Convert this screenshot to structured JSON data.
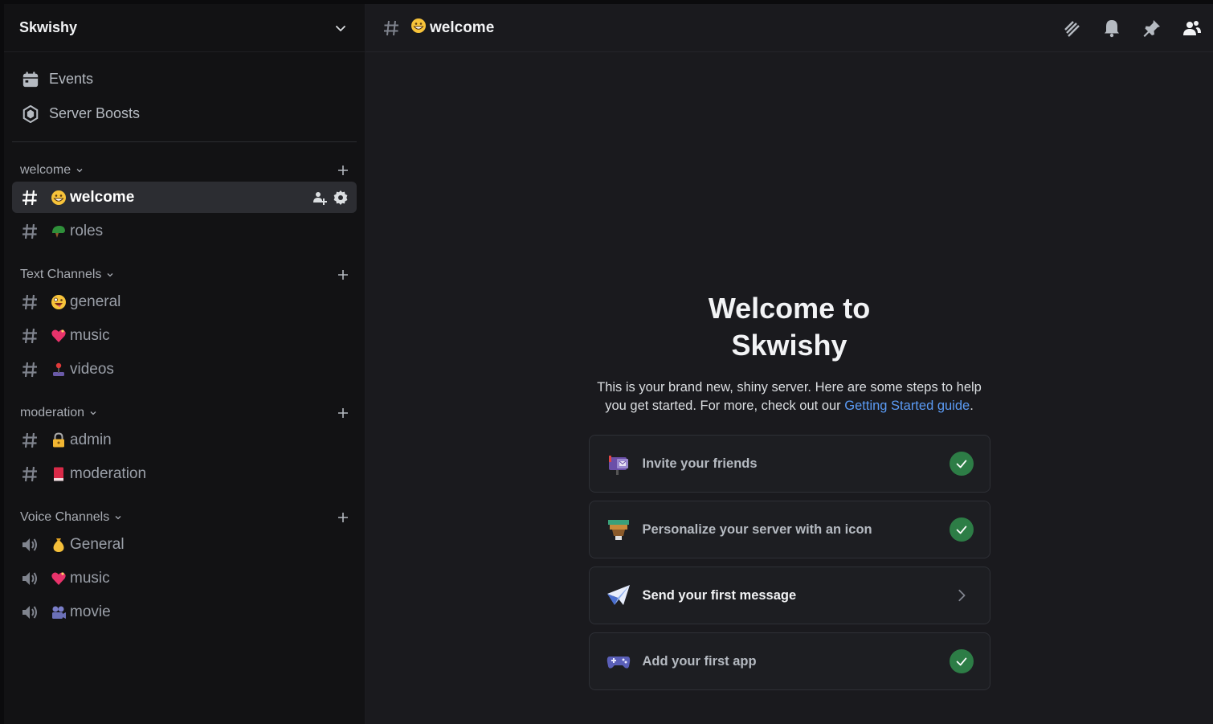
{
  "server": {
    "name": "Skwishy"
  },
  "top_items": [
    {
      "label": "Events",
      "icon": "calendar-icon"
    },
    {
      "label": "Server Boosts",
      "icon": "boost-icon"
    }
  ],
  "categories": [
    {
      "name": "welcome",
      "channels": [
        {
          "name": "welcome",
          "emoji": "grinning-emoji",
          "type": "text",
          "active": true
        },
        {
          "name": "roles",
          "emoji": "helmet-emoji",
          "type": "text"
        }
      ]
    },
    {
      "name": "Text Channels",
      "channels": [
        {
          "name": "general",
          "emoji": "zany-face-emoji",
          "type": "text"
        },
        {
          "name": "music",
          "emoji": "heart-emoji",
          "type": "text"
        },
        {
          "name": "videos",
          "emoji": "joystick-emoji",
          "type": "text"
        }
      ]
    },
    {
      "name": "moderation",
      "channels": [
        {
          "name": "admin",
          "emoji": "lock-emoji",
          "type": "text"
        },
        {
          "name": "moderation",
          "emoji": "red-book-emoji",
          "type": "text"
        }
      ]
    },
    {
      "name": "Voice Channels",
      "channels": [
        {
          "name": "General",
          "emoji": "money-bag-emoji",
          "type": "voice"
        },
        {
          "name": "music",
          "emoji": "heart-emoji",
          "type": "voice"
        },
        {
          "name": "movie",
          "emoji": "camera-emoji",
          "type": "voice"
        }
      ]
    }
  ],
  "topbar": {
    "channel_name": "welcome",
    "icons": [
      "threads-icon",
      "bell-icon",
      "pin-icon",
      "members-icon"
    ]
  },
  "welcome": {
    "title": "Welcome to Skwishy",
    "description_prefix": "This is your brand new, shiny server. Here are some steps to help you get started. For more, check out our ",
    "link_text": "Getting Started guide",
    "description_suffix": "."
  },
  "steps": [
    {
      "label": "Invite your friends",
      "done": true,
      "icon": "mailbox-icon"
    },
    {
      "label": "Personalize your server with an icon",
      "done": true,
      "icon": "paint-brush-icon"
    },
    {
      "label": "Send your first message",
      "done": false,
      "icon": "paper-plane-icon"
    },
    {
      "label": "Add your first app",
      "done": true,
      "icon": "gamepad-icon"
    }
  ],
  "colors": {
    "accent_link": "#5b9bf5",
    "success": "#2d7d46",
    "active_channel_bg": "#2c2d32"
  }
}
